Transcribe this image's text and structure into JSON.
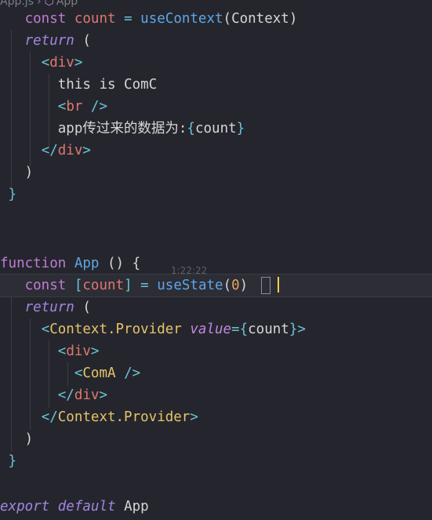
{
  "breadcrumb": {
    "file": "App.js",
    "separator": "›",
    "symbol": "App",
    "symbol_icon": "cube-icon"
  },
  "code": {
    "l1": [
      "const",
      "count",
      "=",
      "useContext",
      "(Context)"
    ],
    "l2": [
      "return",
      "("
    ],
    "l3": [
      "<",
      "div",
      ">"
    ],
    "l4": "this is ComC",
    "l5": [
      "<",
      "br",
      " />"
    ],
    "l6": [
      "app传过来的数据为:",
      "{",
      "count",
      "}"
    ],
    "l7": [
      "</",
      "div",
      ">"
    ],
    "l8": ")",
    "l9": "}",
    "l10": [
      "function",
      "App",
      "()",
      "{"
    ],
    "l11": [
      "const",
      "[",
      "count",
      "]",
      "=",
      "useState",
      "(",
      "0",
      ")"
    ],
    "l12": [
      "return",
      "("
    ],
    "l13": [
      "<",
      "Context.Provider",
      "value",
      "={",
      "count",
      "}>"
    ],
    "l14": [
      "<",
      "div",
      ">"
    ],
    "l15": [
      "<",
      "ComA",
      " />"
    ],
    "l16": [
      "</",
      "div",
      ">"
    ],
    "l17": [
      "</",
      "Context.Provider",
      ">"
    ],
    "l18": ")",
    "l19": "}",
    "l20": [
      "export",
      "default",
      "App"
    ]
  },
  "inline_hint": "1:22:22"
}
